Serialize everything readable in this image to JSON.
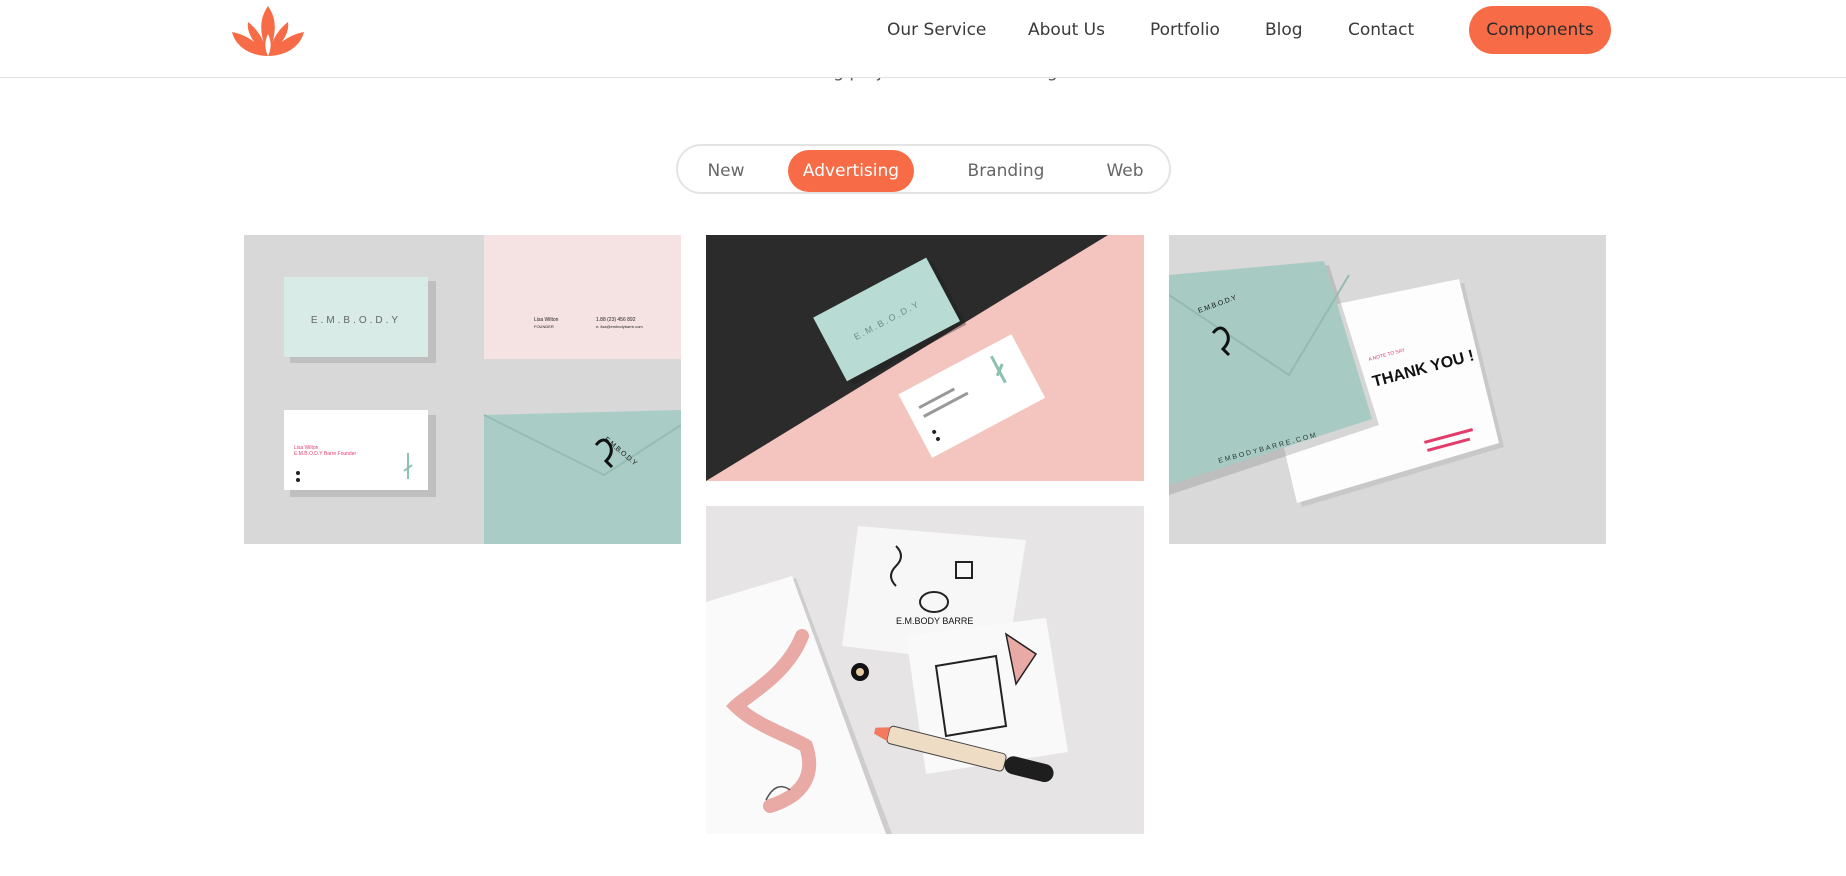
{
  "nav": {
    "items": [
      {
        "label": "Our Service"
      },
      {
        "label": "About Us"
      },
      {
        "label": "Portfolio"
      },
      {
        "label": "Blog"
      },
      {
        "label": "Contact"
      }
    ],
    "cta_label": "Components"
  },
  "section": {
    "subtitle": "New stunning projects for our amazing clients"
  },
  "filters": {
    "tabs": [
      {
        "label": "New"
      },
      {
        "label": "Advertising"
      },
      {
        "label": "Branding"
      },
      {
        "label": "Web"
      }
    ],
    "active": "Advertising"
  },
  "portfolio": {
    "items": [
      {
        "card1_logo": "E.M.B.O.D.Y",
        "card1_name": "Lisa Wilton",
        "card1_role": "FOUNDER",
        "card1_phone": "1.88 (23) 456 892",
        "card1_web": "e: lisa@embodybarre.com",
        "card1_back_name": "Lisa Wilton",
        "card1_back_role": "E.M.B.O.D.Y Barre Founder"
      },
      {
        "card2_logo": "E.M.B.O.D.Y"
      },
      {
        "card3_logo": "E.M.B.O.D.Y",
        "card3_note": "A NOTE TO SAY",
        "card3_thanks": "THANK YOU !",
        "card3_site": "EMBODYBARRE.COM"
      },
      {
        "card4_label": "E.M.BODY BARRE"
      }
    ]
  },
  "colors": {
    "accent": "#f76c47",
    "mint": "#a8d0c8",
    "pink": "#f3c1bd",
    "dark": "#2b2b2b"
  }
}
